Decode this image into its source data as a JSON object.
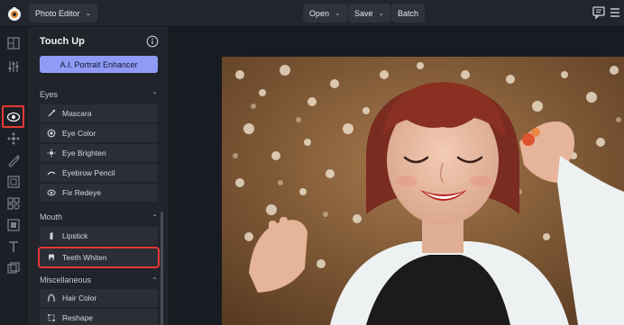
{
  "topbar": {
    "editor_label": "Photo Editor",
    "open_label": "Open",
    "save_label": "Save",
    "batch_label": "Batch",
    "icons": [
      "app-logo-icon",
      "chevron-down-icon",
      "comment-icon",
      "menu-icon"
    ]
  },
  "rail": {
    "icons": [
      "layout-icon",
      "adjust-sliders-icon",
      "eye-icon",
      "effects-icon",
      "paint-icon",
      "frame-icon",
      "graphics-icon",
      "texture-icon",
      "text-icon",
      "layers-icon"
    ],
    "active": "eye-icon"
  },
  "panel": {
    "title": "Touch Up",
    "cta_label": "A.I. Portrait Enhancer",
    "sections": [
      {
        "label": "Eyes",
        "items": [
          "Mascara",
          "Eye Color",
          "Eye Brighten",
          "Eyebrow Pencil",
          "Fix Redeye"
        ]
      },
      {
        "label": "Mouth",
        "items": [
          "Lipstick",
          "Teeth Whiten"
        ]
      },
      {
        "label": "Miscellaneous",
        "items": [
          "Hair Color",
          "Reshape"
        ]
      }
    ],
    "highlighted_item": "Teeth Whiten"
  },
  "colors": {
    "accent": "#8f9bf7",
    "highlight": "#e53935",
    "panel_bg": "#22242c"
  }
}
